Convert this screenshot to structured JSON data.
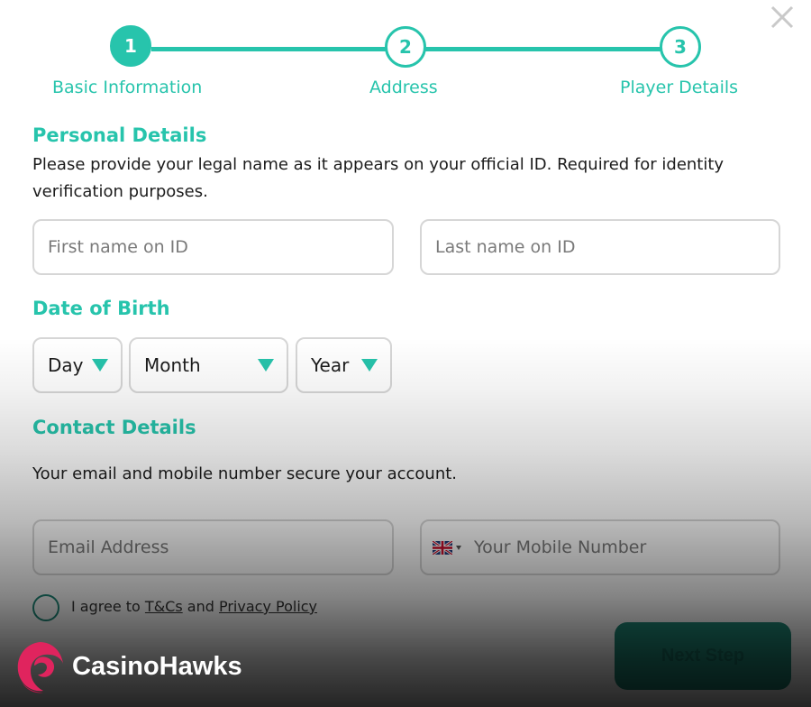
{
  "colors": {
    "accent": "#27c4ac",
    "button": "#1f8a78",
    "border": "#d6d6d6"
  },
  "close": {
    "icon": "close-icon"
  },
  "stepper": {
    "steps": [
      {
        "number": "1",
        "label": "Basic Information",
        "state": "active"
      },
      {
        "number": "2",
        "label": "Address",
        "state": "pending"
      },
      {
        "number": "3",
        "label": "Player Details",
        "state": "pending"
      }
    ]
  },
  "personal": {
    "title": "Personal Details",
    "description": "Please provide your legal name as it appears on your official ID. Required for identity verification purposes.",
    "first_name": {
      "value": "",
      "placeholder": "First name on ID"
    },
    "last_name": {
      "value": "",
      "placeholder": "Last name on ID"
    }
  },
  "dob": {
    "title": "Date of Birth",
    "day": "Day",
    "month": "Month",
    "year": "Year"
  },
  "contact": {
    "title": "Contact Details",
    "description": "Your email and mobile number secure your account.",
    "email": {
      "value": "",
      "placeholder": "Email Address"
    },
    "phone": {
      "value": "",
      "placeholder": "Your Mobile Number",
      "flag_icon": "uk-flag-icon"
    }
  },
  "consent": {
    "prefix": "I agree to",
    "terms_link": "T&Cs",
    "middle": "and",
    "privacy_link": "Privacy Policy",
    "checked": false
  },
  "next_button": {
    "label": "Next Step"
  },
  "watermark": {
    "text": "CasinoHawks",
    "icon": "casinohawks-logo-icon"
  }
}
